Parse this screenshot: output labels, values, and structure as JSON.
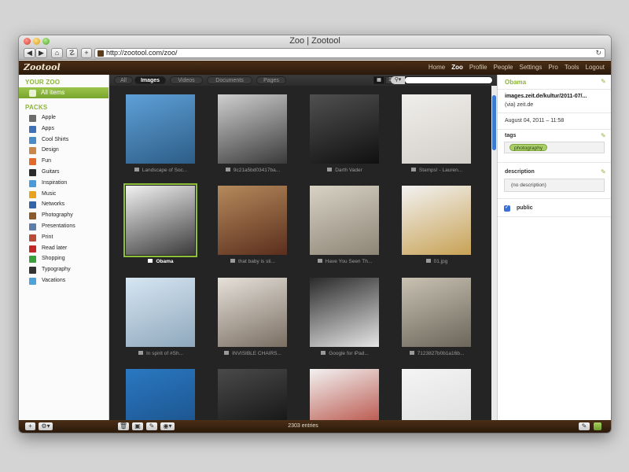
{
  "browser": {
    "window_title": "Zoo | Zootool",
    "url": "http://zootool.com/zoo/",
    "back_label": "◀",
    "forward_label": "▶",
    "home_label": "⌂",
    "bookmark_label": "☡",
    "add_label": "+",
    "reload_label": "↻"
  },
  "app": {
    "logo": "Zootool",
    "nav": [
      "Home",
      "Zoo",
      "Profile",
      "People",
      "Settings",
      "Pro",
      "Tools",
      "Logout"
    ],
    "nav_active": "Zoo"
  },
  "sidebar": {
    "your_zoo_heading": "YOUR ZOO",
    "all_items_label": "All items",
    "packs_heading": "PACKS",
    "packs": [
      {
        "label": "Apple",
        "color": "#6b6b6b"
      },
      {
        "label": "Apps",
        "color": "#3f6fb5"
      },
      {
        "label": "Cool Shirts",
        "color": "#4a8cc8"
      },
      {
        "label": "Design",
        "color": "#c9874a"
      },
      {
        "label": "Fun",
        "color": "#e26a2a"
      },
      {
        "label": "Guitars",
        "color": "#2b2b2b"
      },
      {
        "label": "Inspiration",
        "color": "#4b9ad9"
      },
      {
        "label": "Music",
        "color": "#e9a21c"
      },
      {
        "label": "Networks",
        "color": "#3464a8"
      },
      {
        "label": "Photography",
        "color": "#8a5a2a"
      },
      {
        "label": "Presentations",
        "color": "#5e7da8"
      },
      {
        "label": "Print",
        "color": "#b84b3a"
      },
      {
        "label": "Read later",
        "color": "#c22626"
      },
      {
        "label": "Shopping",
        "color": "#3b9f3b"
      },
      {
        "label": "Typography",
        "color": "#333333"
      },
      {
        "label": "Vacations",
        "color": "#4ea2d8"
      }
    ],
    "add_button": "+",
    "gear_button": "⚙▾"
  },
  "filters": {
    "tabs": [
      "All",
      "Images",
      "Videos",
      "Documents",
      "Pages"
    ],
    "active_tab": "Images",
    "grid_view_label": "▦",
    "list_view_label": "☰",
    "search_icon_label": "⚲▾",
    "search_placeholder": ""
  },
  "grid": {
    "items": [
      {
        "caption": "Landscape of Soc...",
        "colors": [
          "#5ea0d8",
          "#2d5d86"
        ],
        "selected": false
      },
      {
        "caption": "9c21a5bd03417ba...",
        "colors": [
          "#cfcfcf",
          "#3a3a3a"
        ],
        "selected": false
      },
      {
        "caption": "Darth Vader",
        "colors": [
          "#505050",
          "#101010"
        ],
        "selected": false
      },
      {
        "caption": "Stamps! - Lauren...",
        "colors": [
          "#f0eeeb",
          "#d2cfc9"
        ],
        "selected": false
      },
      {
        "caption": "Obama",
        "colors": [
          "#f2f2f2",
          "#3a3a3a"
        ],
        "selected": true
      },
      {
        "caption": "that baby is sti...",
        "colors": [
          "#b58a5c",
          "#5a2e1c"
        ],
        "selected": false
      },
      {
        "caption": "Have You Seen Th...",
        "colors": [
          "#d8d2c5",
          "#8d8576"
        ],
        "selected": false
      },
      {
        "caption": "01.jpg",
        "colors": [
          "#f2f2f2",
          "#c8a255"
        ],
        "selected": false
      },
      {
        "caption": "In spirit of #Sh...",
        "colors": [
          "#d6e6f2",
          "#8fa8bd"
        ],
        "selected": false
      },
      {
        "caption": "INVISIBLE CHAIRS...",
        "colors": [
          "#e6e1da",
          "#7a6e62"
        ],
        "selected": false
      },
      {
        "caption": "Google for iPad...",
        "colors": [
          "#2a2a2a",
          "#e6e6e6"
        ],
        "selected": false
      },
      {
        "caption": "7123827b0b1a16b...",
        "colors": [
          "#c9c2b3",
          "#6b655a"
        ],
        "selected": false
      },
      {
        "caption": "",
        "colors": [
          "#2a78c2",
          "#1a4f86"
        ],
        "selected": false
      },
      {
        "caption": "",
        "colors": [
          "#4a4a4a",
          "#0d0d0d"
        ],
        "selected": false
      },
      {
        "caption": "",
        "colors": [
          "#f2f2f2",
          "#b03a2e"
        ],
        "selected": false
      },
      {
        "caption": "",
        "colors": [
          "#f4f4f4",
          "#dcdcdc"
        ],
        "selected": false
      }
    ],
    "entries_count": "2303 entries"
  },
  "detail": {
    "title": "Obama",
    "source_url": "images.zeit.de/kultur/2011-07/...",
    "via": "(via) zeit.de",
    "timestamp": "August 04, 2011 – 11:58",
    "tags_label": "tags",
    "tags": [
      "photography"
    ],
    "description_label": "description",
    "description_value": "(no description)",
    "public_label": "public"
  },
  "footer_buttons": {
    "trash": "🗑",
    "image": "▣",
    "edit": "✎",
    "share": "◉▾",
    "pencil": "✎",
    "info": "i"
  }
}
